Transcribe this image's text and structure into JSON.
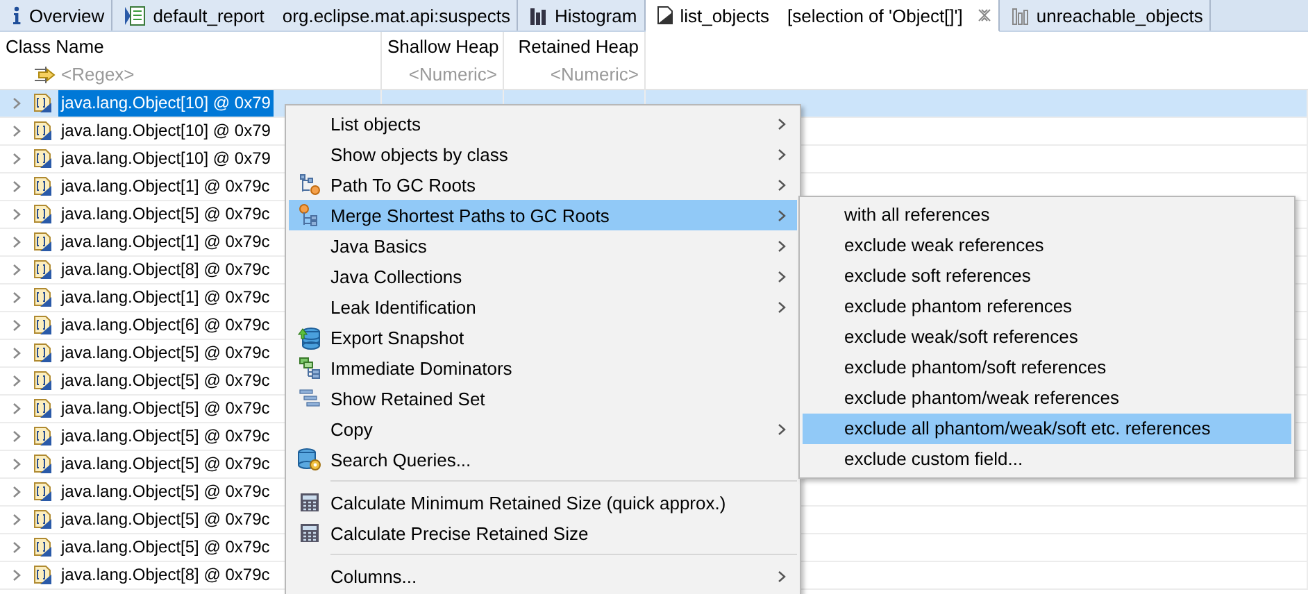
{
  "tabs": [
    {
      "label": "Overview",
      "selected": false
    },
    {
      "label": "default_report",
      "detail": "org.eclipse.mat.api:suspects",
      "selected": false
    },
    {
      "label": "Histogram",
      "selected": false
    },
    {
      "label": "list_objects",
      "detail": "[selection of 'Object[]']",
      "selected": true,
      "closable": true
    },
    {
      "label": "unreachable_objects",
      "selected": false
    }
  ],
  "table": {
    "columns": [
      {
        "label": "Class Name",
        "filter": "<Regex>"
      },
      {
        "label": "Shallow Heap",
        "filter": "<Numeric>"
      },
      {
        "label": "Retained Heap",
        "filter": "<Numeric>"
      }
    ],
    "rows": [
      {
        "name": "java.lang.Object[10] @ 0x79",
        "selected": true
      },
      {
        "name": "java.lang.Object[10] @ 0x79",
        "selected": false
      },
      {
        "name": "java.lang.Object[10] @ 0x79",
        "selected": false
      },
      {
        "name": "java.lang.Object[1] @ 0x79c",
        "selected": false
      },
      {
        "name": "java.lang.Object[5] @ 0x79c",
        "selected": false
      },
      {
        "name": "java.lang.Object[1] @ 0x79c",
        "selected": false
      },
      {
        "name": "java.lang.Object[8] @ 0x79c",
        "selected": false
      },
      {
        "name": "java.lang.Object[1] @ 0x79c",
        "selected": false
      },
      {
        "name": "java.lang.Object[6] @ 0x79c",
        "selected": false
      },
      {
        "name": "java.lang.Object[5] @ 0x79c",
        "selected": false
      },
      {
        "name": "java.lang.Object[5] @ 0x79c",
        "selected": false
      },
      {
        "name": "java.lang.Object[5] @ 0x79c",
        "selected": false
      },
      {
        "name": "java.lang.Object[5] @ 0x79c",
        "selected": false
      },
      {
        "name": "java.lang.Object[5] @ 0x79c",
        "selected": false
      },
      {
        "name": "java.lang.Object[5] @ 0x79c",
        "selected": false
      },
      {
        "name": "java.lang.Object[5] @ 0x79c",
        "selected": false
      },
      {
        "name": "java.lang.Object[5] @ 0x79c",
        "selected": false
      },
      {
        "name": "java.lang.Object[8] @ 0x79c",
        "selected": false
      }
    ]
  },
  "context_menu": {
    "items": [
      {
        "kind": "item",
        "label": "List objects",
        "submenu": true,
        "selected": false
      },
      {
        "kind": "item",
        "label": "Show objects by class",
        "submenu": true,
        "selected": false
      },
      {
        "kind": "item",
        "label": "Path To GC Roots",
        "submenu": true,
        "selected": false
      },
      {
        "kind": "item",
        "label": "Merge Shortest Paths to GC Roots",
        "submenu": true,
        "selected": true
      },
      {
        "kind": "item",
        "label": "Java Basics",
        "submenu": true,
        "selected": false
      },
      {
        "kind": "item",
        "label": "Java Collections",
        "submenu": true,
        "selected": false
      },
      {
        "kind": "item",
        "label": "Leak Identification",
        "submenu": true,
        "selected": false
      },
      {
        "kind": "item",
        "label": "Export Snapshot",
        "submenu": false,
        "selected": false
      },
      {
        "kind": "item",
        "label": "Immediate Dominators",
        "submenu": false,
        "selected": false
      },
      {
        "kind": "item",
        "label": "Show Retained Set",
        "submenu": false,
        "selected": false
      },
      {
        "kind": "item",
        "label": "Copy",
        "submenu": true,
        "selected": false
      },
      {
        "kind": "item",
        "label": "Search Queries...",
        "submenu": false,
        "selected": false
      },
      {
        "kind": "separator"
      },
      {
        "kind": "item",
        "label": "Calculate Minimum Retained Size (quick approx.)",
        "submenu": false,
        "selected": false
      },
      {
        "kind": "item",
        "label": "Calculate Precise Retained Size",
        "submenu": false,
        "selected": false
      },
      {
        "kind": "separator"
      },
      {
        "kind": "item",
        "label": "Columns...",
        "submenu": true,
        "selected": false
      }
    ]
  },
  "submenu": {
    "items": [
      {
        "label": "with all references",
        "selected": false
      },
      {
        "label": "exclude weak references",
        "selected": false
      },
      {
        "label": "exclude soft references",
        "selected": false
      },
      {
        "label": "exclude phantom references",
        "selected": false
      },
      {
        "label": "exclude weak/soft references",
        "selected": false
      },
      {
        "label": "exclude phantom/soft references",
        "selected": false
      },
      {
        "label": "exclude phantom/weak references",
        "selected": false
      },
      {
        "label": "exclude all phantom/weak/soft etc. references",
        "selected": true
      },
      {
        "label": "exclude custom field...",
        "selected": false
      }
    ]
  }
}
